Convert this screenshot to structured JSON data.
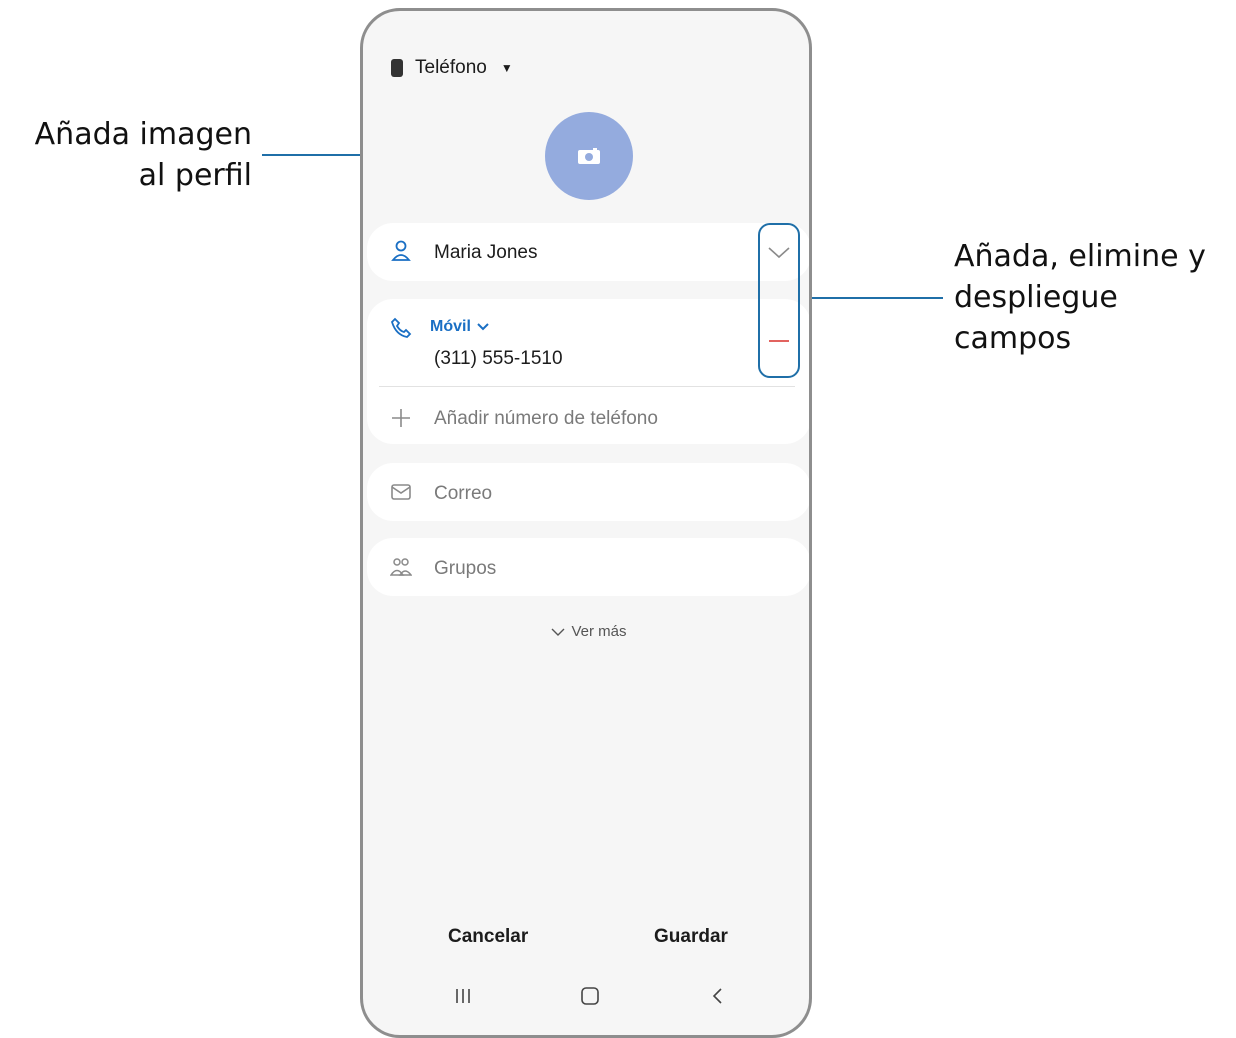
{
  "callouts": {
    "left_line1": "Añada imagen",
    "left_line2": "al perfil",
    "right_line1": "Añada, elimine y",
    "right_line2": "despliegue",
    "right_line3": "campos"
  },
  "account": {
    "label": "Teléfono",
    "icon": "phone-icon"
  },
  "avatar": {
    "icon": "camera-icon",
    "color": "#94abde"
  },
  "fields": {
    "name": {
      "value": "Maria Jones",
      "icon": "person-icon"
    },
    "phone": {
      "type_label": "Móvil",
      "value": "(311) 555-1510",
      "icon": "phone-call-icon"
    },
    "add_phone": {
      "label": "Añadir número de teléfono",
      "icon": "plus-icon"
    },
    "email": {
      "placeholder": "Correo",
      "icon": "envelope-icon"
    },
    "groups": {
      "placeholder": "Grupos",
      "icon": "group-icon"
    }
  },
  "see_more": "Ver más",
  "actions": {
    "cancel": "Cancelar",
    "save": "Guardar"
  },
  "nav": [
    "recents-icon",
    "home-icon",
    "back-icon"
  ],
  "colors": {
    "accent": "#1a6fc4",
    "callout": "#1f6fa8",
    "remove": "#e2635f"
  }
}
